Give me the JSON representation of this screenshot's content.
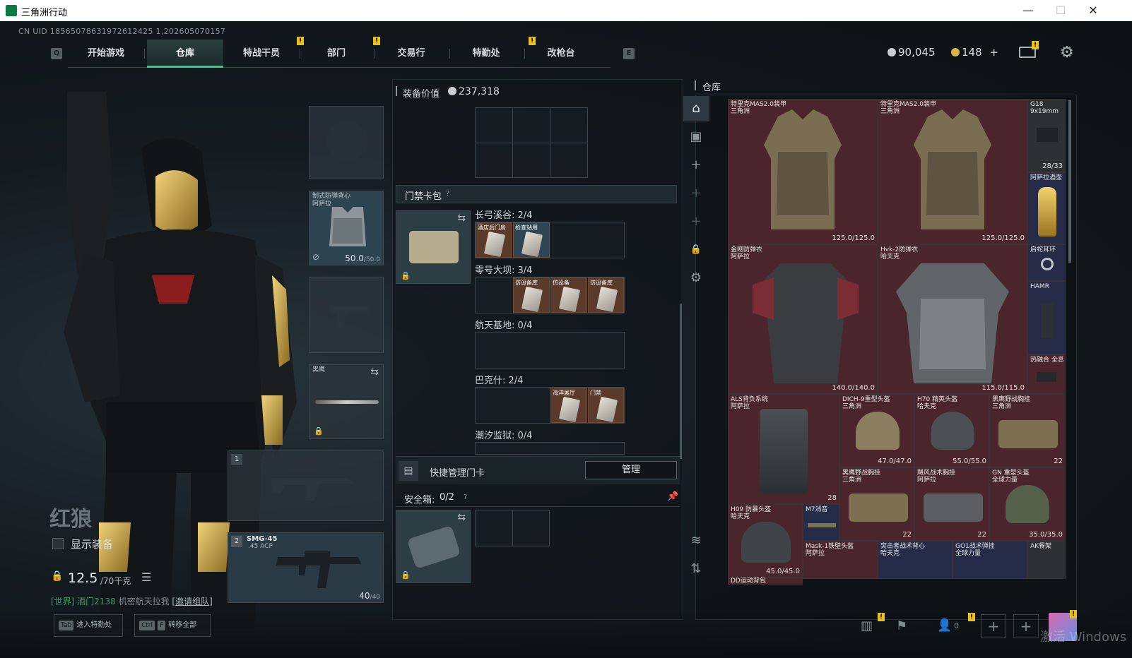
{
  "window": {
    "title": "三角洲行动",
    "min": "—",
    "max": "☐",
    "close": "✕"
  },
  "uid": "CN UID 18565078631972612425 1,202605070157",
  "nav": {
    "q_key": "Q",
    "e_key": "E",
    "tabs": [
      "开始游戏",
      "仓库",
      "特战干员",
      "部门",
      "交易行",
      "特勤处",
      "改枪台"
    ],
    "active": "仓库",
    "notif_mark": "!"
  },
  "currency": {
    "silver": "90,045",
    "gold": "148",
    "plus": "+"
  },
  "operator": {
    "name": "红狼",
    "show_gear_label": "显示装备",
    "weight": "12.5",
    "weight_max": "/70千克",
    "chat_channel": "[世界]",
    "chat_user": "酒门2138",
    "chat_text": "机密航天拉我",
    "chat_link": "[邀请组队]"
  },
  "equip_slots": {
    "vest_label": "制式防弹背心\n阿萨拉",
    "vest_dur": "50.0",
    "vest_dur_max": "/50.0",
    "melee_label": "黑鹰",
    "primary_num": "1",
    "secondary_num": "2",
    "secondary_name": "SMG-45",
    "secondary_ammo": ".45 ACP",
    "secondary_mag": "40",
    "secondary_mag_max": "/40"
  },
  "mid": {
    "equip_value_label": "装备价值",
    "equip_value": "237,318",
    "keycard_header": "门禁卡包",
    "keycard_help": "?",
    "maps": [
      {
        "name": "长弓溪谷: 2/4",
        "cards": [
          "酒店后门房",
          "检查站用"
        ]
      },
      {
        "name": "零号大坝: 3/4",
        "cards": [
          "",
          "仿设备库",
          "仿设备",
          "仿设备库"
        ]
      },
      {
        "name": "航天基地: 0/4",
        "cards": []
      },
      {
        "name": "巴克什: 2/4",
        "cards": [
          "",
          "",
          "海洋展厅",
          "门禁"
        ]
      },
      {
        "name": "潮汐监狱: 0/4",
        "cards": []
      }
    ],
    "quick_manage": "快捷管理门卡",
    "manage_btn": "管理",
    "safebox_label": "安全箱:",
    "safebox_count": "0/2",
    "safebox_help": "?"
  },
  "storage": {
    "title": "仓库",
    "items": [
      {
        "name": "特里克MAS2.0装甲\n三角洲",
        "stat": "125.0/125.0",
        "color": "red"
      },
      {
        "name": "特里克MAS2.0装甲\n三角洲",
        "stat": "125.0/125.0",
        "color": "red"
      },
      {
        "name": "G18\n9x19mm",
        "stat": "28/33",
        "color": "gray"
      },
      {
        "name": "阿萨拉酒壶",
        "stat": "",
        "color": "blue"
      },
      {
        "name": "金刚防弹衣\n阿萨拉",
        "stat": "140.0/140.0",
        "color": "red"
      },
      {
        "name": "Hvk-2防弹衣\n哈夫克",
        "stat": "115.0/115.0",
        "color": "red"
      },
      {
        "name": "启蛇耳环",
        "stat": "",
        "color": "blue"
      },
      {
        "name": "HAMR",
        "stat": "",
        "color": "blue"
      },
      {
        "name": "热融合 全息",
        "stat": "",
        "color": "red"
      },
      {
        "name": "ALS背负系统\n阿萨拉",
        "stat": "28",
        "color": "red"
      },
      {
        "name": "DICH-9重型头盔\n三角洲",
        "stat": "47.0/47.0",
        "color": "red"
      },
      {
        "name": "H70 精英头盔\n哈夫克",
        "stat": "55.0/55.0",
        "color": "red"
      },
      {
        "name": "黑鹰野战胸挂\n三角洲",
        "stat": "22",
        "color": "red"
      },
      {
        "name": "黑鹰野战胸挂\n三角洲",
        "stat": "22",
        "color": "red"
      },
      {
        "name": "飓风战术胸挂\n阿萨拉",
        "stat": "22",
        "color": "red"
      },
      {
        "name": "GN 重型头盔\n全球力量",
        "stat": "35.0/35.0",
        "color": "red"
      },
      {
        "name": "H09 防暴头盔\n哈夫克",
        "stat": "45.0/45.0",
        "color": "red"
      },
      {
        "name": "M7消音",
        "stat": "",
        "color": "blue"
      },
      {
        "name": "Mask-1铁壁头盔\n阿萨拉",
        "stat": "",
        "color": "red"
      },
      {
        "name": "突击者战术背心\n哈夫克",
        "stat": "",
        "color": "blue"
      },
      {
        "name": "GO1战术弹挂\n全球力量",
        "stat": "",
        "color": "blue"
      },
      {
        "name": "AK餐架",
        "stat": "",
        "color": "gray"
      },
      {
        "name": "DD运动背包",
        "stat": "",
        "color": "red"
      }
    ]
  },
  "bottom": {
    "tab_key": "Tab",
    "tab_label": "进入特勤处",
    "ctrl_key": "Ctrl",
    "f_key": "F",
    "ctrl_label": "转移全部",
    "friends": "0",
    "watermark": "激活 Windows"
  },
  "colors": {
    "accent": "#2fd38a",
    "notif": "#e8c21a",
    "rare_red": "#4a262c",
    "rare_blue": "#262c48"
  }
}
